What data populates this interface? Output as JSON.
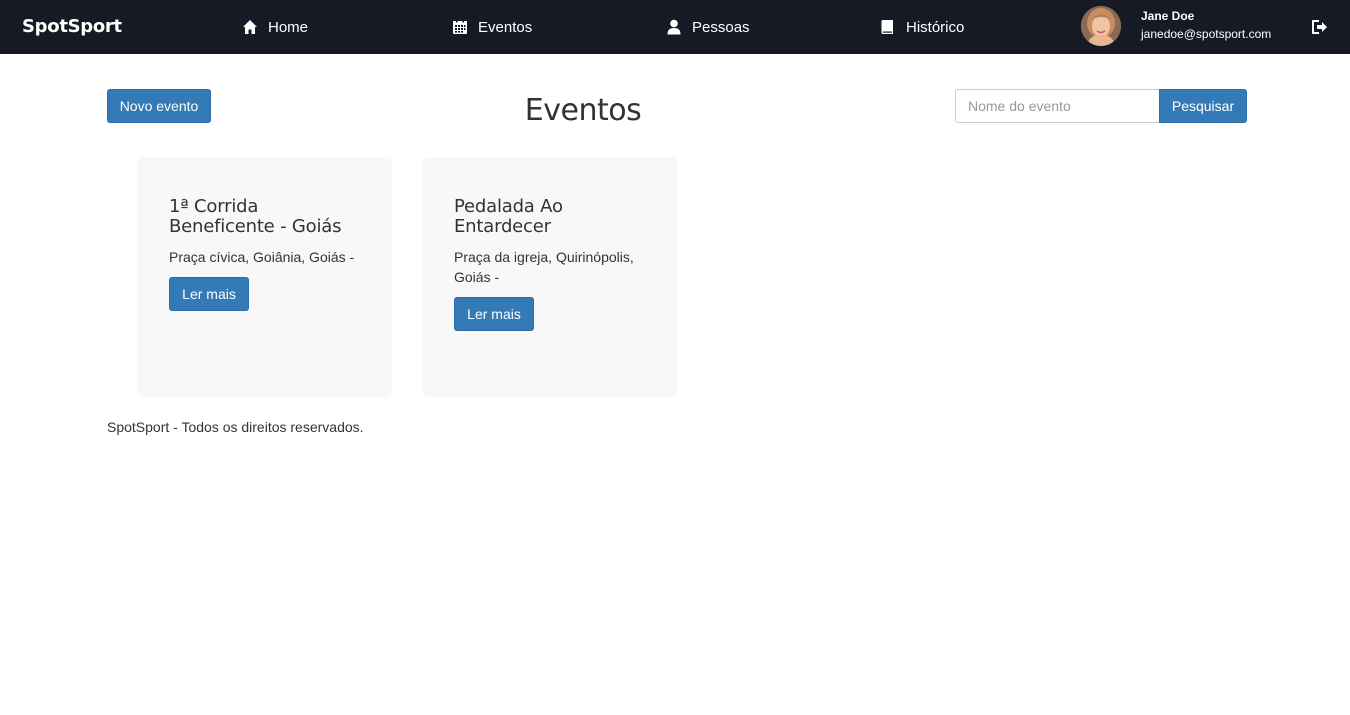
{
  "navbar": {
    "brand": "SpotSport",
    "items": [
      {
        "label": "Home",
        "icon": "home-icon"
      },
      {
        "label": "Eventos",
        "icon": "calendar-icon"
      },
      {
        "label": "Pessoas",
        "icon": "user-icon"
      },
      {
        "label": "Histórico",
        "icon": "book-icon"
      }
    ],
    "user": {
      "name": "Jane Doe",
      "email": "janedoe@spotsport.com"
    },
    "logout_icon": "logout-icon"
  },
  "toolbar": {
    "new_event_label": "Novo evento",
    "search_placeholder": "Nome do evento",
    "search_button_label": "Pesquisar"
  },
  "page": {
    "title": "Eventos"
  },
  "events": [
    {
      "title": "1ª Corrida Beneficente - Goiás",
      "location": "Praça cívica, Goiânia, Goiás -",
      "button_label": "Ler mais"
    },
    {
      "title": "Pedalada Ao Entardecer",
      "location": "Praça da igreja, Quirinópolis, Goiás -",
      "button_label": "Ler mais"
    }
  ],
  "footer": {
    "text": "SpotSport - Todos os direitos reservados."
  },
  "colors": {
    "navbar_bg": "#151a25",
    "primary": "#337ab7",
    "card_bg": "#f8f8f8"
  }
}
